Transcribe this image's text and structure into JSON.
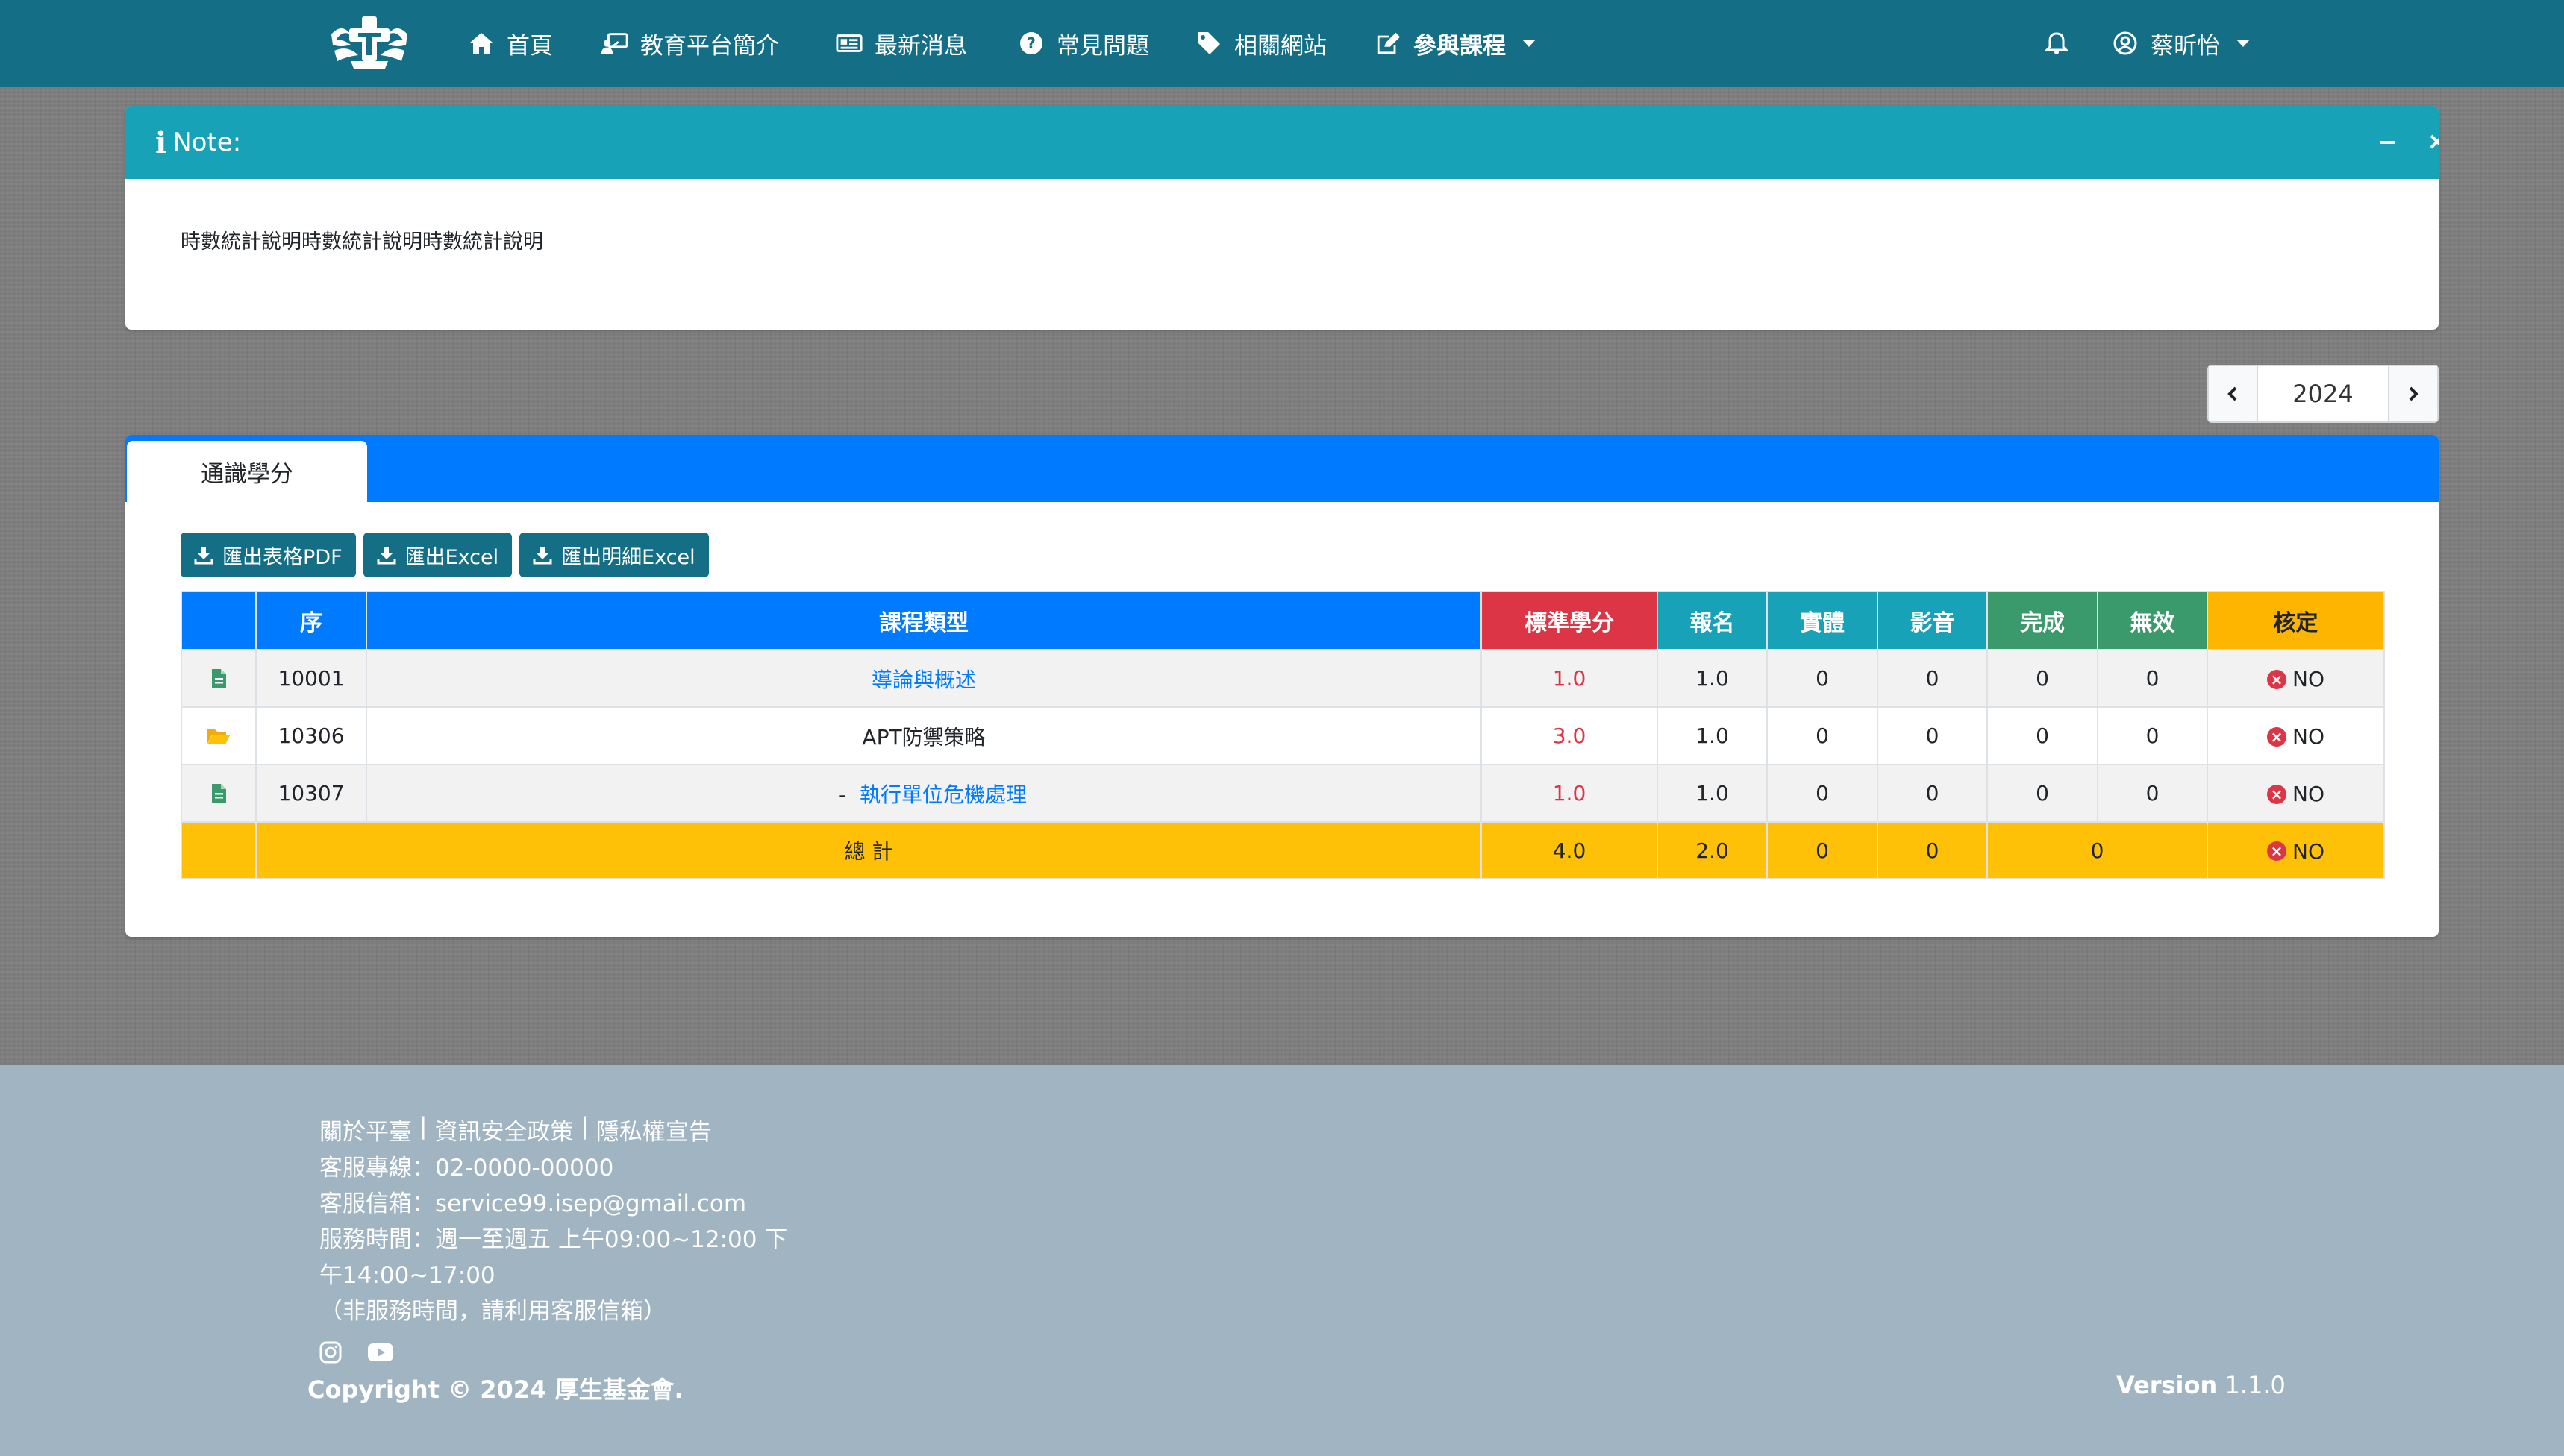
{
  "nav": {
    "items": [
      {
        "icon": "home-icon",
        "label": "首頁"
      },
      {
        "icon": "presentation-icon",
        "label": "教育平台簡介"
      },
      {
        "icon": "newspaper-icon",
        "label": "最新消息"
      },
      {
        "icon": "question-circle-icon",
        "label": "常見問題"
      },
      {
        "icon": "tag-icon",
        "label": "相關網站"
      },
      {
        "icon": "edit-icon",
        "label": "參與課程"
      }
    ],
    "user_name": "蔡昕怡"
  },
  "note": {
    "title": "Note:",
    "body": "時數統計說明時數統計說明時數統計說明"
  },
  "year_pager": {
    "year": "2024"
  },
  "tabs": [
    {
      "label": "通識學分",
      "active": true
    }
  ],
  "buttons": {
    "export_pdf": "匯出表格PDF",
    "export_excel": "匯出Excel",
    "export_detail_excel": "匯出明細Excel"
  },
  "table": {
    "headers": [
      "",
      "序",
      "課程類型",
      "標準學分",
      "報名",
      "實體",
      "影音",
      "完成",
      "無效",
      "核定"
    ],
    "rows": [
      {
        "icon": "file-icon",
        "seq": "10001",
        "name": "導論與概述",
        "is_link": true,
        "prefix": "",
        "std_credit": "1.0",
        "signup": "1.0",
        "physical": "0",
        "video": "0",
        "done": "0",
        "invalid": "0",
        "approved": "NO"
      },
      {
        "icon": "folder-open-icon",
        "seq": "10306",
        "name": "APT防禦策略",
        "is_link": false,
        "prefix": "",
        "std_credit": "3.0",
        "signup": "1.0",
        "physical": "0",
        "video": "0",
        "done": "0",
        "invalid": "0",
        "approved": "NO"
      },
      {
        "icon": "file-icon",
        "seq": "10307",
        "name": "執行單位危機處理",
        "is_link": true,
        "prefix": "-",
        "std_credit": "1.0",
        "signup": "1.0",
        "physical": "0",
        "video": "0",
        "done": "0",
        "invalid": "0",
        "approved": "NO"
      }
    ],
    "total": {
      "label": "總 計",
      "std_credit": "4.0",
      "signup": "2.0",
      "physical": "0",
      "video": "0",
      "done_invalid": "0",
      "approved": "NO"
    }
  },
  "footer": {
    "links": [
      "關於平臺",
      "資訊安全政策",
      "隱私權宣告"
    ],
    "separator": "|",
    "hotline": "客服專線：02-0000-00000",
    "email": "客服信箱：service99.isep@gmail.com",
    "hours_1": "服務時間：週一至週五 上午09:00~12:00 下",
    "hours_2": "午14:00~17:00",
    "hours_note": "（非服務時間，請利用客服信箱）",
    "social": [
      "instagram-icon",
      "youtube-icon"
    ],
    "copyright": "Copyright © 2024 厚生基金會.",
    "version_label": "Version",
    "version_num": "1.1.0"
  },
  "colors": {
    "navbar": "#136e86",
    "note_header": "#17a2b8",
    "tab_bar": "#007bff",
    "header_blue": "#007bff",
    "header_red": "#dc3545",
    "header_teal": "#17a2b8",
    "header_green": "#3b9a6b",
    "header_yellow": "#fdb500",
    "total_row": "#ffc107",
    "footer": "#a0b4c2"
  }
}
